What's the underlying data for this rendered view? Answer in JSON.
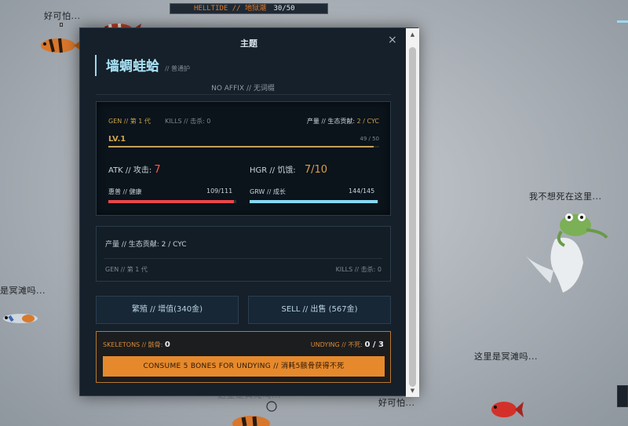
{
  "hud": {
    "event_text": "HELLTIDE // 地狱潮",
    "count": "30/50"
  },
  "scene_texts": {
    "t1": "好可怕...",
    "t2": "我不想死在这里...",
    "t3": "是冥滩吗...",
    "t4": "这里是冥滩吗...",
    "t5": "这里是冥滩吗...",
    "t6": "好可怕..."
  },
  "modal": {
    "title": "主题",
    "close": "×",
    "name": "墙蜩蛙蛤",
    "name_sub": "// 普通护",
    "affix": "NO AFFIX // 无词缀",
    "stats": {
      "gen": "GEN // 第 1 代",
      "kills": "KILLS // 击杀: 0",
      "prod": "产量 // 生态贡献:",
      "prod_value": "2 / CYC",
      "level": "LV.1",
      "xp": "49 / 50",
      "xp_fraction": 0.98,
      "atk_label": "ATK // 攻击:",
      "atk_value": "7",
      "hgr_label": "HGR // 饥饿:",
      "hgr_value": "7/10",
      "hp_label": "惠普 // 健康",
      "hp_value": "109/111",
      "hp_fraction": 0.982,
      "grw_label": "GRW // 成长",
      "grw_value": "144/145",
      "grw_fraction": 0.993
    },
    "eco": {
      "prod": "产量 // 生态贡献: 2 / CYC",
      "gen": "GEN // 第 1 代",
      "kills": "KILLS // 击杀: 0"
    },
    "buttons": {
      "breed": "繁殖 // 增值(340金)",
      "sell": "SELL // 出售 (567金)"
    },
    "bones": {
      "skeletons_label": "SKELETONS // 骸骨:",
      "skeletons_value": "0",
      "undying_label": "UNDYING // 不死:",
      "undying_value": "0 / 3",
      "consume": "CONSUME 5 BONES FOR UNDYING // 消耗5骸骨获得不死"
    }
  },
  "colors": {
    "hp": "#e8484a",
    "grw": "#86d8f2",
    "accent": "#e5892c",
    "name": "#a9e2f5"
  }
}
